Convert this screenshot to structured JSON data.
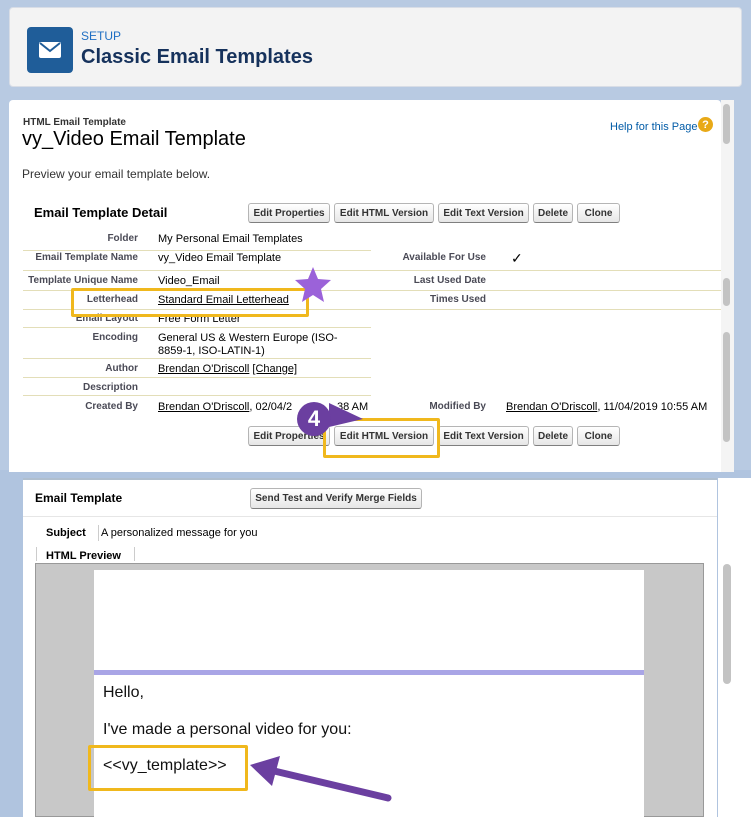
{
  "header": {
    "setup_label": "SETUP",
    "title": "Classic Email Templates",
    "icon": "envelope-icon",
    "icon_color": "#1f5d99"
  },
  "template": {
    "kicker": "HTML Email Template",
    "name": "vy_Video Email Template",
    "help_link": "Help for this Page",
    "preview_note": "Preview your email template below."
  },
  "detail": {
    "section_title": "Email Template Detail",
    "buttons": [
      "Edit Properties",
      "Edit HTML Version",
      "Edit Text Version",
      "Delete",
      "Clone"
    ],
    "fields": {
      "folder_label": "Folder",
      "folder_value": "My Personal Email Templates",
      "name_label": "Email Template Name",
      "name_value": "vy_Video Email Template",
      "unique_label": "Template Unique Name",
      "unique_value": "Video_Email",
      "letterhead_label": "Letterhead",
      "letterhead_value": "Standard Email Letterhead",
      "layout_label": "Email Layout",
      "layout_value": "Free Form Letter",
      "encoding_label": "Encoding",
      "encoding_line1": "General US & Western Europe (ISO-",
      "encoding_line2": "8859-1, ISO-LATIN-1)",
      "author_label": "Author",
      "author_value": "Brendan O'Driscoll",
      "change_link": "[Change]",
      "description_label": "Description",
      "created_label": "Created By",
      "created_name": "Brendan O'Driscoll",
      "created_date": ", 02/04/2",
      "created_time": "38 AM",
      "available_label": "Available For Use",
      "available_check": "✓",
      "last_used_label": "Last Used Date",
      "times_used_label": "Times Used",
      "modified_label": "Modified By",
      "modified_name": "Brendan O'Driscoll",
      "modified_date": ", 11/04/2019 10:55 AM"
    },
    "bottom_buttons": [
      "Edit Properties",
      "Edit HTML Version",
      "Edit Text Version",
      "Delete",
      "Clone"
    ]
  },
  "annotations": {
    "step_number": "4",
    "highlight_color": "#f0b81d",
    "step_color": "#6b3fa0",
    "star_color": "#9b62d9"
  },
  "email_section": {
    "title": "Email Template",
    "send_test_button": "Send Test and Verify Merge Fields",
    "subject_label": "Subject",
    "subject_value": "A personalized message for you",
    "preview_tab": "HTML Preview"
  },
  "preview": {
    "greeting": "Hello,",
    "body_line": "I've made a personal video for you:",
    "merge_field": "<<vy_template>>",
    "accent_bar_color": "#a9a5e6"
  }
}
